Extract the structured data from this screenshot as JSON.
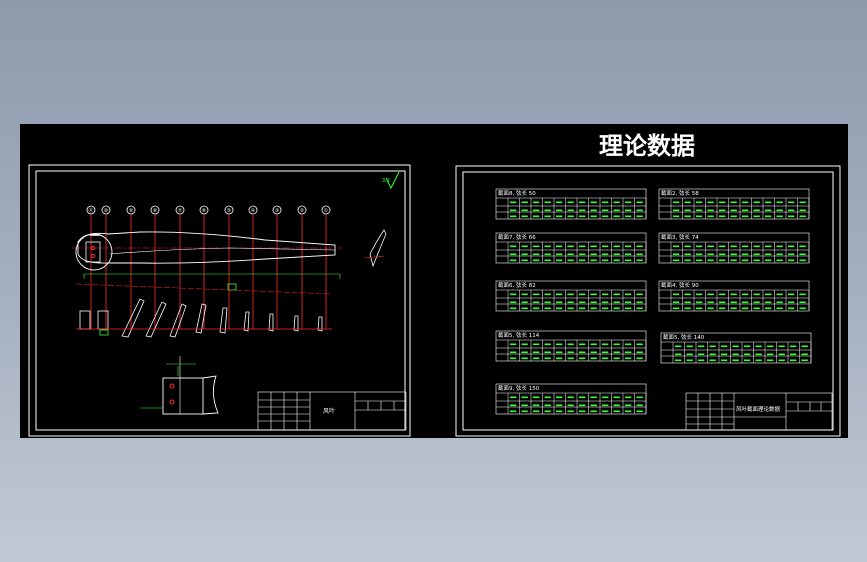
{
  "colors": {
    "frame": "#ffffff",
    "table_line": "#ffffff",
    "table_text": "#33ff33",
    "geometry": "#ff2a2a",
    "accent": "#ffff33",
    "background": "#000000"
  },
  "sheet1": {
    "title_block": {
      "name": "风叶"
    },
    "balloons": [
      "⑪",
      "⑩",
      "⑨",
      "⑧",
      "⑦",
      "⑥",
      "⑤",
      "④",
      "③",
      "②",
      "①"
    ],
    "surface_mark": "3.2"
  },
  "sheet2": {
    "heading": "理论数据",
    "title_block": {
      "name": "风叶截面理论数据"
    },
    "sections": [
      {
        "label": "截面8, 弦长 50"
      },
      {
        "label": "截面2, 弦长 58"
      },
      {
        "label": "截面7, 弦长 66"
      },
      {
        "label": "截面3, 弦长 74"
      },
      {
        "label": "截面6, 弦长 82"
      },
      {
        "label": "截面4, 弦长 90"
      },
      {
        "label": "截面5, 弦长 114"
      },
      {
        "label": "截面5, 弦长 140"
      },
      {
        "label": "截面9, 弦长 150"
      }
    ]
  }
}
